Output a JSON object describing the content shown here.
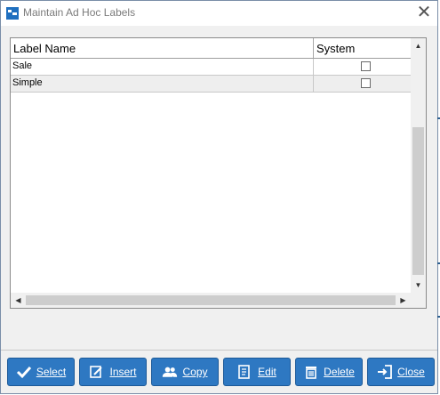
{
  "window": {
    "title": "Maintain Ad Hoc Labels"
  },
  "grid": {
    "columns": [
      "Label Name",
      "System"
    ],
    "rows": [
      {
        "label": "Sale",
        "system": false
      },
      {
        "label": "Simple",
        "system": false
      }
    ]
  },
  "buttons": {
    "select": "Select",
    "insert": "Insert",
    "copy": "Copy",
    "edit": "Edit",
    "delete": "Delete",
    "close": "Close"
  },
  "colors": {
    "button_bg": "#2e78c2",
    "button_text": "#ffffff"
  }
}
